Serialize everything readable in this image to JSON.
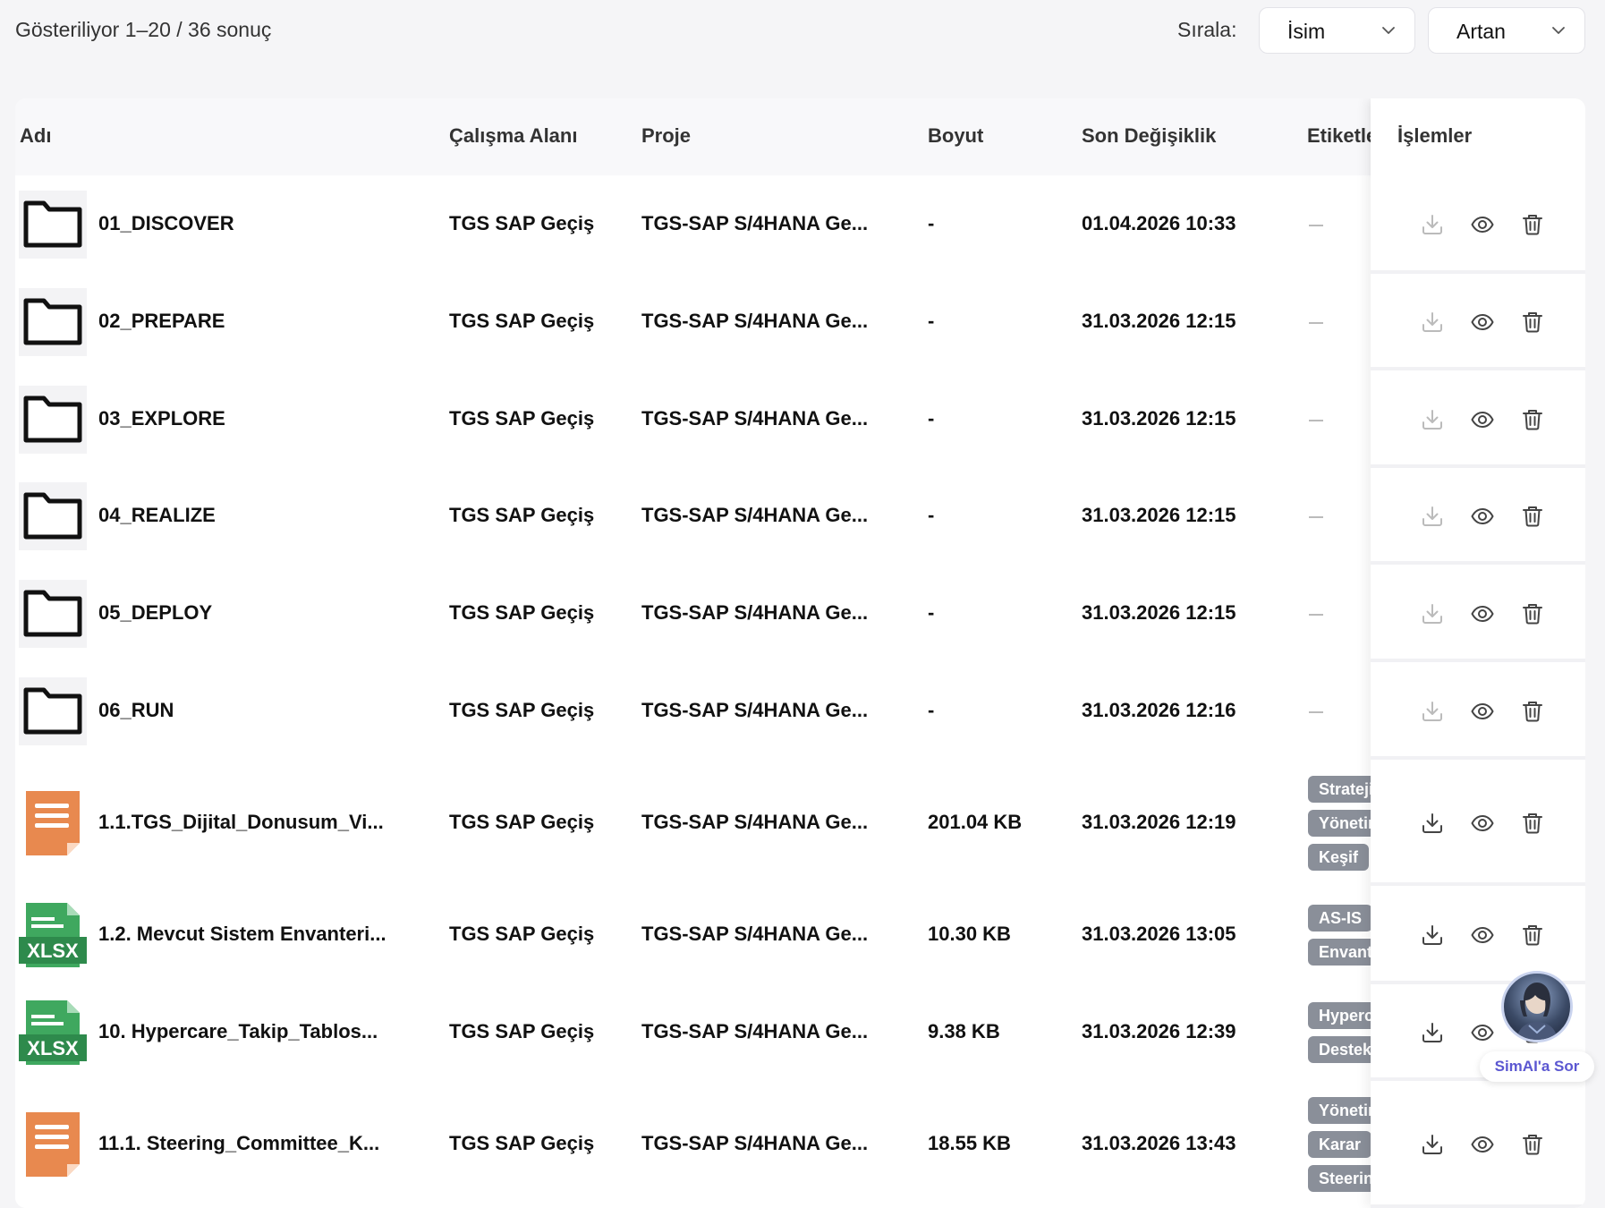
{
  "toolbar": {
    "result_count": "Gösteriliyor 1–20 / 36 sonuç",
    "sort_label": "Sırala:",
    "sort_value": "İsim",
    "order_value": "Artan"
  },
  "table": {
    "headers": {
      "name": "Adı",
      "workspace": "Çalışma Alanı",
      "project": "Proje",
      "size": "Boyut",
      "modified": "Son Değişiklik",
      "tags": "Etiketler",
      "actions": "İşlemler"
    },
    "rows": [
      {
        "name": "01_DISCOVER",
        "type": "folder",
        "workspace": "TGS SAP Geçiş",
        "project": "TGS-SAP S/4HANA Ge...",
        "size": "-",
        "modified": "01.04.2026 10:33",
        "tags": []
      },
      {
        "name": "02_PREPARE",
        "type": "folder",
        "workspace": "TGS SAP Geçiş",
        "project": "TGS-SAP S/4HANA Ge...",
        "size": "-",
        "modified": "31.03.2026 12:15",
        "tags": []
      },
      {
        "name": "03_EXPLORE",
        "type": "folder",
        "workspace": "TGS SAP Geçiş",
        "project": "TGS-SAP S/4HANA Ge...",
        "size": "-",
        "modified": "31.03.2026 12:15",
        "tags": []
      },
      {
        "name": "04_REALIZE",
        "type": "folder",
        "workspace": "TGS SAP Geçiş",
        "project": "TGS-SAP S/4HANA Ge...",
        "size": "-",
        "modified": "31.03.2026 12:15",
        "tags": []
      },
      {
        "name": "05_DEPLOY",
        "type": "folder",
        "workspace": "TGS SAP Geçiş",
        "project": "TGS-SAP S/4HANA Ge...",
        "size": "-",
        "modified": "31.03.2026 12:15",
        "tags": []
      },
      {
        "name": "06_RUN",
        "type": "folder",
        "workspace": "TGS SAP Geçiş",
        "project": "TGS-SAP S/4HANA Ge...",
        "size": "-",
        "modified": "31.03.2026 12:16",
        "tags": []
      },
      {
        "name": "1.1.TGS_Dijital_Donusum_Vi...",
        "type": "doc",
        "workspace": "TGS SAP Geçiş",
        "project": "TGS-SAP S/4HANA Ge...",
        "size": "201.04 KB",
        "modified": "31.03.2026 12:19",
        "tags": [
          "Strateji",
          "Yönetim",
          "Keşif"
        ]
      },
      {
        "name": "1.2. Mevcut Sistem Envanteri...",
        "type": "xlsx",
        "icon_label": "XLSX",
        "workspace": "TGS SAP Geçiş",
        "project": "TGS-SAP S/4HANA Ge...",
        "size": "10.30 KB",
        "modified": "31.03.2026 13:05",
        "tags": [
          "AS-IS",
          "Envanter"
        ]
      },
      {
        "name": "10. Hypercare_Takip_Tablos...",
        "type": "xlsx",
        "icon_label": "XLSX",
        "workspace": "TGS SAP Geçiş",
        "project": "TGS-SAP S/4HANA Ge...",
        "size": "9.38 KB",
        "modified": "31.03.2026 12:39",
        "tags": [
          "Hypercare",
          "Destek"
        ]
      },
      {
        "name": "11.1. Steering_Committee_K...",
        "type": "doc",
        "workspace": "TGS SAP Geçiş",
        "project": "TGS-SAP S/4HANA Ge...",
        "size": "18.55 KB",
        "modified": "31.03.2026 13:43",
        "tags": [
          "Yönetim",
          "Karar",
          "Steering"
        ]
      }
    ]
  },
  "assistant": {
    "label": "SimAI'a Sor"
  },
  "colors": {
    "doc": "#e8894f",
    "xlsx": "#3fa85f",
    "tag": "#8a8f99",
    "accent": "#5b57d1"
  }
}
